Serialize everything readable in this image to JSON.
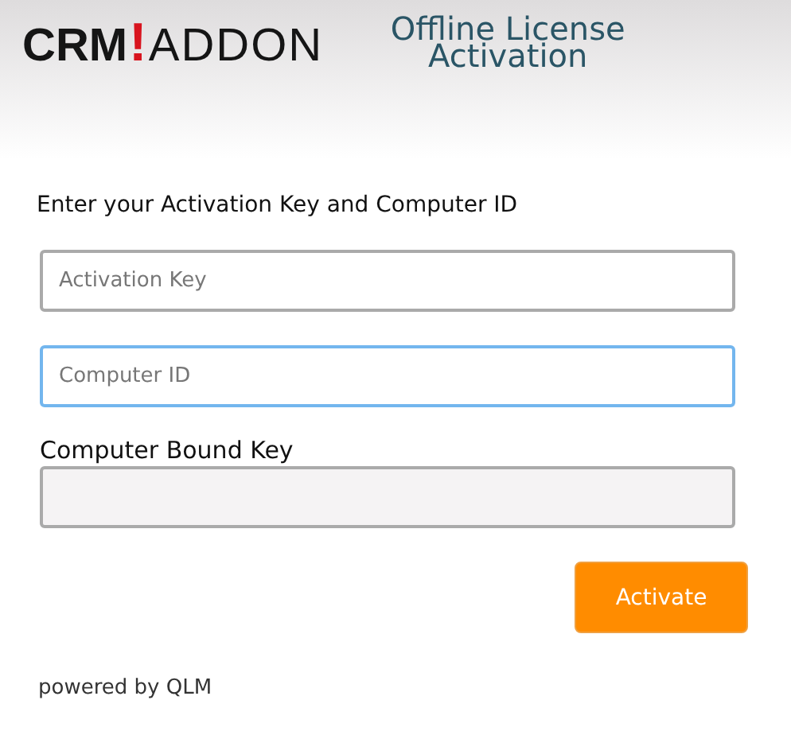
{
  "header": {
    "logo": {
      "left": "CRM",
      "mark": "!",
      "right": "ADDON"
    },
    "title": "Offline License Activation"
  },
  "instruction": "Enter your Activation Key and Computer ID",
  "fields": [
    {
      "placeholder": "Activation Key",
      "focused": false,
      "disabled": false
    },
    {
      "placeholder": "Computer ID",
      "focused": true,
      "disabled": false
    },
    {
      "label": "Computer Bound Key",
      "focused": false,
      "disabled": true
    }
  ],
  "button": "Activate",
  "footer": "powered by QLM"
}
